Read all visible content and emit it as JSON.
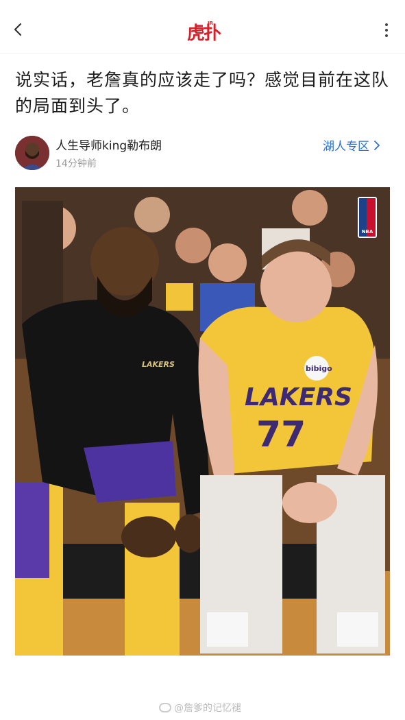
{
  "header": {
    "back_icon": "chevron-left-icon",
    "logo_text": "虎扑",
    "logo_superscript": "JR",
    "more_icon": "more-vertical-icon"
  },
  "post": {
    "title": "说实话，老詹真的应该走了吗？感觉目前在这队的局面到头了。",
    "author_name": "人生导师king勒布朗",
    "time_ago": "14分钟前",
    "section_label": "湖人专区"
  },
  "photo": {
    "logo_text": "NBA",
    "jersey_team_text": "LAKERS",
    "jersey_number": "77",
    "jersey_sponsor": "bibigo",
    "warmup_text": "LAKERS"
  },
  "watermark": {
    "text": "@詹爹的记忆褪"
  },
  "colors": {
    "accent_red": "#d4212a",
    "link_blue": "#2f6fd0",
    "lakers_gold": "#f3c63a",
    "lakers_purple": "#552583"
  }
}
